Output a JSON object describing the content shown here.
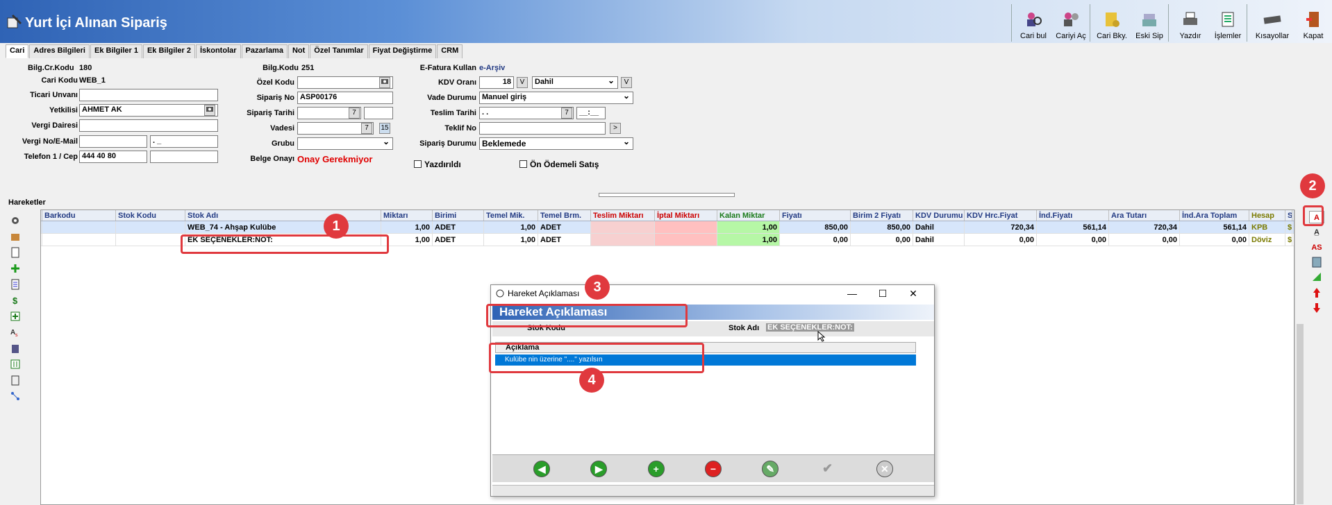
{
  "window": {
    "title": "Yurt İçi Alınan Sipariş"
  },
  "toolbar": {
    "buttons": [
      {
        "label": "Cari bul",
        "icon": "search-person-icon"
      },
      {
        "label": "Cariyi Aç",
        "icon": "open-person-icon"
      },
      {
        "label": "Cari Bky.",
        "icon": "balance-icon"
      },
      {
        "label": "Eski Sip",
        "icon": "old-order-icon"
      },
      {
        "label": "Yazdır",
        "icon": "printer-icon"
      },
      {
        "label": "İşlemler",
        "icon": "operations-icon"
      },
      {
        "label": "Kısayollar",
        "icon": "keyboard-icon"
      },
      {
        "label": "Kapat",
        "icon": "exit-icon"
      }
    ]
  },
  "tabs": [
    "Cari",
    "Adres Bilgileri",
    "Ek Bilgiler 1",
    "Ek Bilgiler 2",
    "İskontolar",
    "Pazarlama",
    "Not",
    "Özel Tanımlar",
    "Fiyat Değiştirme",
    "CRM"
  ],
  "form": {
    "bilg_cr_kodu_label": "Bilg.Cr.Kodu",
    "bilg_cr_kodu": "180",
    "cari_kodu_label": "Cari Kodu",
    "cari_kodu": "WEB_1",
    "ticari_unvani_label": "Ticari Unvanı",
    "ticari_unvani": "",
    "yetkilisi_label": "Yetkilisi",
    "yetkilisi": "AHMET  AK",
    "vergi_dairesi_label": "Vergi Dairesi",
    "vergi_no_label": "Vergi No/E-Mail",
    "vergi_no": "",
    "email": ".      _",
    "telefon_label": "Telefon 1 / Cep",
    "telefon": "444 40 80",
    "cep": "",
    "bilg_kodu_label": "Bilg.Kodu",
    "bilg_kodu": "251",
    "ozel_kodu_label": "Özel Kodu",
    "siparis_no_label": "Sipariş No",
    "siparis_no": "ASP00176",
    "siparis_tarihi_label": "Sipariş Tarihi",
    "vadesi_label": "Vadesi",
    "grubu_label": "Grubu",
    "belge_onayi_label": "Belge Onayı",
    "belge_onayi": "Onay Gerekmiyor",
    "efatura_label": "E-Fatura Kullan",
    "efatura": "e-Arşiv",
    "kdv_orani_label": "KDV Oranı",
    "kdv_orani": "18",
    "kdv_dahil": "Dahil",
    "v_label": "V",
    "vade_durumu_label": "Vade Durumu",
    "vade_durumu": "Manuel giriş",
    "teslim_tarihi_label": "Teslim Tarihi",
    "teslim_tarihi": ". .",
    "teslim_saat": "__:__",
    "teklif_no_label": "Teklif No",
    "teklif_arrow": ">",
    "siparis_durumu_label": "Sipariş Durumu",
    "siparis_durumu": "Beklemede",
    "yazdirildi_label": "Yazdırıldı",
    "on_odemeli_label": "Ön Ödemeli Satış"
  },
  "hareketler": {
    "label": "Hareketler",
    "columns": [
      "Barkodu",
      "Stok Kodu",
      "Stok Adı",
      "Miktarı",
      "Birimi",
      "Temel Mik.",
      "Temel Brm.",
      "Teslim Miktarı",
      "İptal Miktarı",
      "Kalan Miktar",
      "Fiyatı",
      "Birim 2 Fiyatı",
      "KDV Durumu",
      "KDV Hrc.Fiyat",
      "İnd.Fiyatı",
      "Ara Tutarı",
      "İnd.Ara Toplam",
      "Hesap",
      "S"
    ],
    "rows": [
      {
        "barkodu": "",
        "stok_kodu": "",
        "stok_adi": "WEB_74 - Ahşap Kulübe",
        "miktari": "1,00",
        "birimi": "ADET",
        "temel_mik": "1,00",
        "temel_brm": "ADET",
        "teslim": "",
        "iptal": "",
        "kalan": "1,00",
        "fiyati": "850,00",
        "birim2": "850,00",
        "kdv_durumu": "Dahil",
        "kdv_hrc": "720,34",
        "ind_fiyati": "561,14",
        "ara_tutari": "720,34",
        "ind_ara": "561,14",
        "hesap": "KPB",
        "s": "$"
      },
      {
        "barkodu": "",
        "stok_kodu": "",
        "stok_adi": "EK SEÇENEKLER:NOT:",
        "miktari": "1,00",
        "birimi": "ADET",
        "temel_mik": "1,00",
        "temel_brm": "ADET",
        "teslim": "",
        "iptal": "",
        "kalan": "1,00",
        "fiyati": "0,00",
        "birim2": "0,00",
        "kdv_durumu": "Dahil",
        "kdv_hrc": "0,00",
        "ind_fiyati": "0,00",
        "ara_tutari": "0,00",
        "ind_ara": "0,00",
        "hesap": "Döviz",
        "s": "$"
      }
    ]
  },
  "right_icons": [
    "A",
    "A̲",
    "AS"
  ],
  "dialog": {
    "title": "Hareket Açıklaması",
    "header": "Hareket Açıklaması",
    "stok_kodu_label": "Stok Kodu",
    "stok_adi_label": "Stok Adı",
    "stok_adi": "EK SEÇENEKLER:NOT:",
    "column": "Açıklama",
    "row_text": "Kulübe nin üzerine \"....\" yazılsın"
  },
  "callouts": [
    "1",
    "2",
    "3",
    "4"
  ],
  "colors": {
    "callout": "#e0393e",
    "header_blue": "#2f63b5",
    "selected_row": "#0078d7",
    "kalan_green": "#b6f7a6",
    "iptal_red": "#ffc0c0"
  }
}
